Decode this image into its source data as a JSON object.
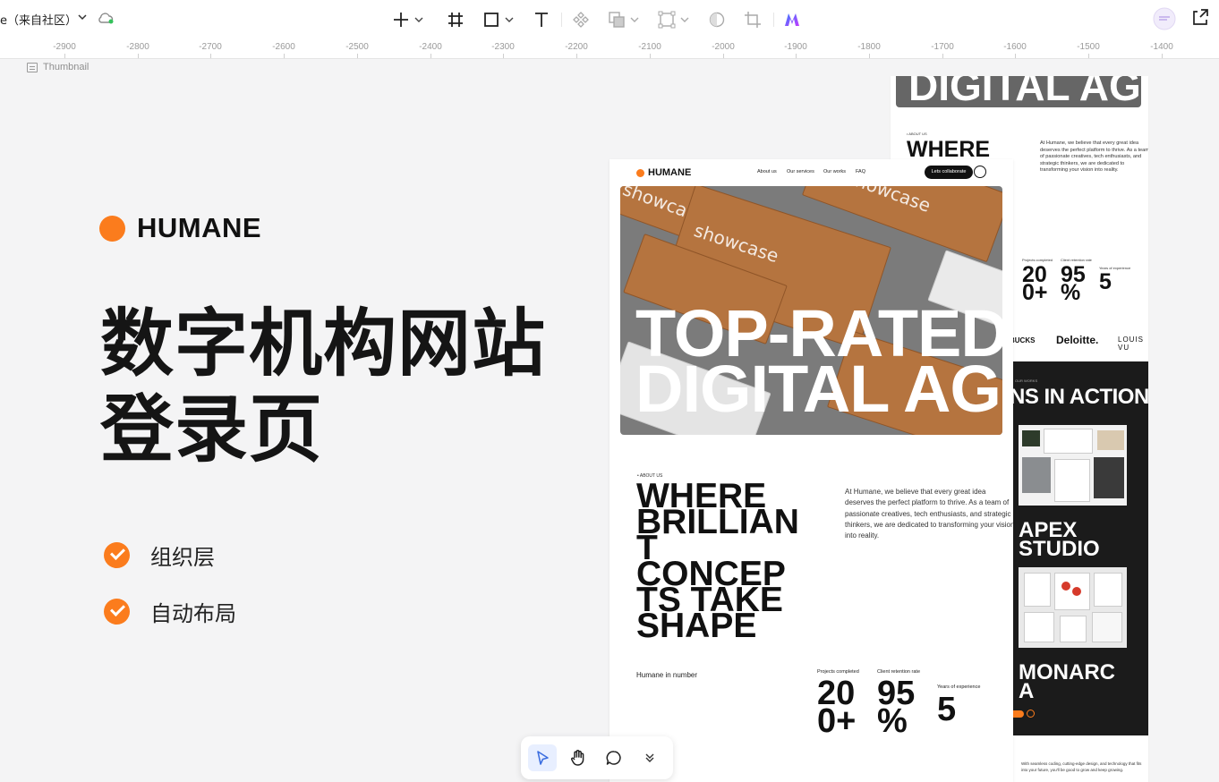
{
  "toolbar": {
    "doc_title": "e（来自社区）",
    "accent": "#fb7c1d"
  },
  "ruler": {
    "ticks": [
      "-2900",
      "-2800",
      "-2700",
      "-2600",
      "-2500",
      "-2400",
      "-2300",
      "-2200",
      "-2100",
      "-2000",
      "-1900",
      "-1800",
      "-1700",
      "-1600",
      "-1500",
      "-1400"
    ]
  },
  "canvas": {
    "frame_label": "Thumbnail"
  },
  "cover": {
    "brand": "HUMANE",
    "headline_line1": "数字机构网站",
    "headline_line2": "登录页",
    "feature1": "组织层",
    "feature2": "自动布局"
  },
  "mock_front": {
    "logo": "HUMANE",
    "nav": [
      "About us",
      "Our services",
      "Our works",
      "FAQ"
    ],
    "cta": "Lets collaborate",
    "hero_line1": "TOP-RATED",
    "hero_line2": "DIGITAL AG",
    "box_text": "showcase",
    "about_tag": "• ABOUT US",
    "where_lines": [
      "WHERE",
      "BRILLIAN",
      "T",
      "CONCEP",
      "TS TAKE",
      "SHAPE"
    ],
    "paragraph": "At Humane, we believe that every great idea deserves the perfect platform to thrive. As a team of passionate creatives, tech enthusiasts, and strategic thinkers, we are dedicated to transforming your vision into reality.",
    "numbers_label": "Humane in number",
    "stats": [
      {
        "label": "Projects completed",
        "value_l1": "20",
        "value_l2": "0+"
      },
      {
        "label": "Client retention rate",
        "value_l1": "95",
        "value_l2": "%"
      },
      {
        "label": "Years of experience",
        "value_l1": "5",
        "value_l2": ""
      }
    ]
  },
  "mock_back": {
    "hero": "DIGITAL AG",
    "about_tag": "• ABOUT US",
    "where": "WHERE BRILLIAN",
    "paragraph": "At Humane, we believe that every great idea deserves the perfect platform to thrive. As a team of passionate creatives, tech enthusiasts, and strategic thinkers, we are dedicated to transforming your vision into reality.",
    "stats": [
      {
        "label": "Projects completed",
        "value_l1": "20",
        "value_l2": "0+"
      },
      {
        "label": "Client retention rate",
        "value_l1": "95",
        "value_l2": "%"
      },
      {
        "label": "Years of experience",
        "value_l1": "5",
        "value_l2": ""
      }
    ],
    "logos": [
      "BUCKS",
      "Deloitte.",
      "LOUIS VU"
    ],
    "works_tag": "OUR WORKS",
    "action": "NS IN ACTION",
    "apex": [
      "APEX",
      "STUDIO"
    ],
    "monarc": [
      "MONARC",
      "A"
    ],
    "footer": "With seamless coding, cutting-edge design, and technology that fits into your future, you'll be good to grow and keep growing."
  }
}
